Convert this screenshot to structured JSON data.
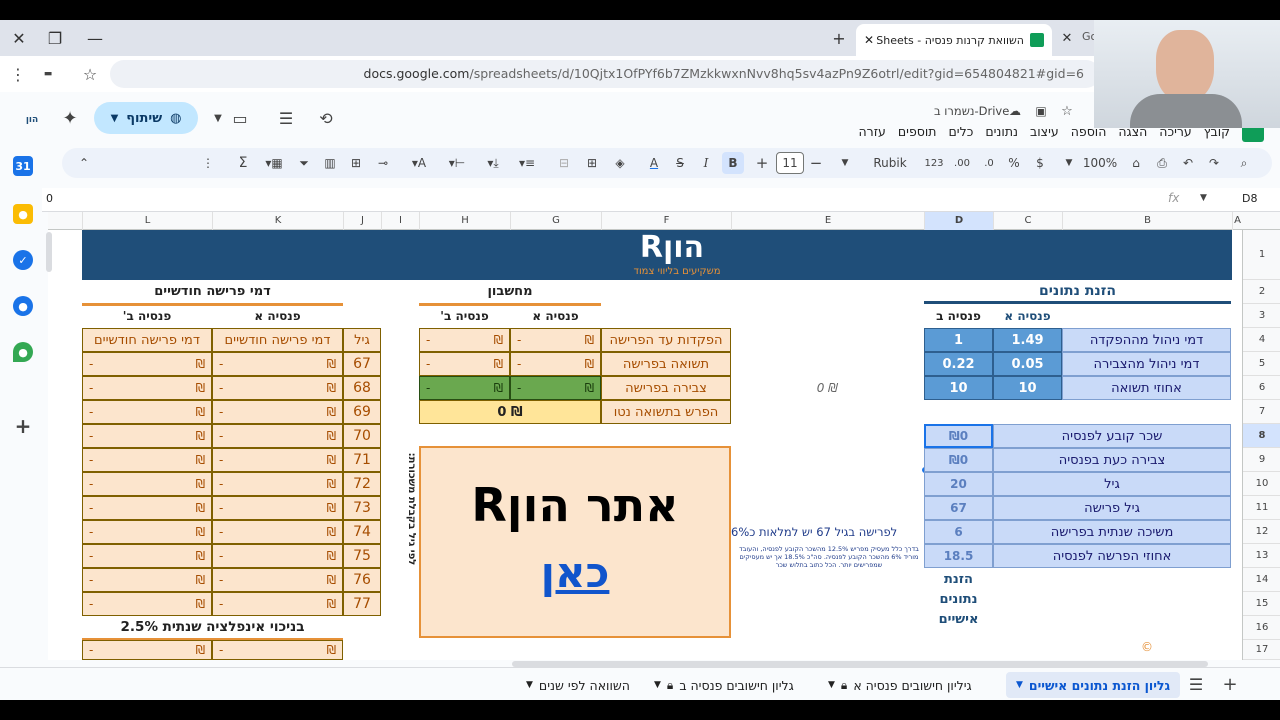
{
  "browser": {
    "tabs": [
      {
        "label": "השוואת קרנות פנסיה - Sheets",
        "active": true
      },
      {
        "label": "Go",
        "active": false
      }
    ],
    "url_host": "docs.google.com",
    "url_path": "/spreadsheets/d/10Qjtx1OfPYf6b7ZMzkkwxnNvv8hq5sv4azPn9Z6otrl/edit?gid=654804821#gid=6"
  },
  "docs": {
    "drive_status": "נשמרו ב-Drive",
    "menu": [
      "קובץ",
      "עריכה",
      "הצגה",
      "הוספה",
      "עיצוב",
      "נתונים",
      "כלים",
      "תוספים",
      "עזרה"
    ],
    "share_label": "שיתוף",
    "brand_color": "#0f9d58",
    "toolbar": {
      "zoom": "100%",
      "currency": "$",
      "percent": "%",
      "decimals_less": ".0",
      "decimals_more": ".00",
      "format_123": "123",
      "font": "Rubik",
      "font_size": "11",
      "bold": "B",
      "italic": "I",
      "strike": "S",
      "text_color": "A"
    },
    "name_box": "D8",
    "fx": "fx",
    "formula_value": "0"
  },
  "grid": {
    "columns": [
      "A",
      "B",
      "C",
      "D",
      "E",
      "F",
      "G",
      "H",
      "I",
      "J",
      "K",
      "L"
    ],
    "rows": [
      "1",
      "2",
      "3",
      "4",
      "5",
      "6",
      "7",
      "8",
      "9",
      "10",
      "11",
      "12",
      "13",
      "14",
      "15",
      "16",
      "17"
    ]
  },
  "banner": {
    "logo_main": "הוןR",
    "logo_sub": "משקיעים בליווי צמוד",
    "bg": "#1f4e79"
  },
  "input_section": {
    "title": "הזנת נתונים",
    "col_a": "פנסיה א",
    "col_b": "פנסיה ב",
    "rows": [
      {
        "label": "דמי ניהול מההפקדה",
        "a": "1.49",
        "b": "1"
      },
      {
        "label": "דמי ניהול מהצבירה",
        "a": "0.05",
        "b": "0.22"
      },
      {
        "label": "אחוזי תשואה",
        "a": "10",
        "b": "10"
      }
    ],
    "e6": "₪ 0",
    "personal": [
      {
        "label": "שכר קובע לפנסיה",
        "value": "₪0"
      },
      {
        "label": "צבירה כעת בפנסיה",
        "value": "₪0"
      },
      {
        "label": "גיל",
        "value": "20"
      },
      {
        "label": "גיל פרישה",
        "value": "67"
      },
      {
        "label": "משיכה שנתית בפרישה",
        "value": "6"
      },
      {
        "label": "אחוזי הפרשה לפנסיה",
        "value": "18.5"
      }
    ],
    "note_main": "לפרישה בגיל 67 יש למלאות כ6%",
    "note_small": "בדרך כלל מעסיק מפריש 12.5% מהשכר הקובע לפנסיה, והעובד מוריד 6% מהשכר הקובע לפנסיה. סה\"כ 18.5% אך יש מעסיקים שמפרישים יותר. הכל כתוב בתלוש שכר",
    "personal_title": "הזנת נתונים אישיים"
  },
  "calc_section": {
    "title": "מחשבון",
    "col_a": "פנסיה א",
    "col_b": "פנסיה ב'",
    "rows": [
      {
        "label": "הפקדות עד הפרישה",
        "a": "-",
        "b": "-",
        "cur": "₪"
      },
      {
        "label": "תשואה בפרישה",
        "a": "-",
        "b": "-",
        "cur": "₪"
      },
      {
        "label": "צבירה בפרישה",
        "a": "-",
        "b": "-",
        "cur": "₪"
      }
    ],
    "net_label": "הפרש בתשואה נטו",
    "net_value": "₪ 0",
    "site_line1": "אתר הוןR",
    "site_line2": "כאן",
    "vertical_text": "לפי גיל בקבלת משכורת:"
  },
  "monthly_section": {
    "title": "דמי פרישה חודשיים",
    "col_a": "פנסיה א",
    "col_b": "פנסיה ב'",
    "age_header": "גיל",
    "value_header": "דמי פרישה חודשיים",
    "ages": [
      "67",
      "68",
      "69",
      "70",
      "71",
      "72",
      "73",
      "74",
      "75",
      "76",
      "77"
    ],
    "dash": "-",
    "cur": "₪",
    "inflation_label": "בניכוי אינפלציה שנתית 2.5%"
  },
  "sheet_tabs": [
    {
      "label": "גליון הזנת נתונים אישיים",
      "active": true,
      "locked": false
    },
    {
      "label": "גיליון חישובים פנסיה א",
      "active": false,
      "locked": true
    },
    {
      "label": "גליון חישובים פנסיה ב",
      "active": false,
      "locked": true
    },
    {
      "label": "השוואה לפי שנים",
      "active": false,
      "locked": false
    }
  ]
}
